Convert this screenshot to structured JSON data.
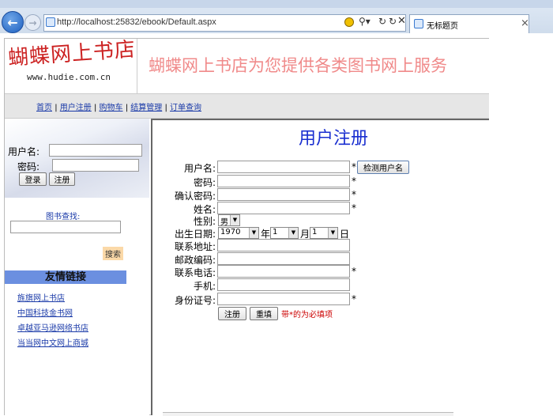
{
  "browser": {
    "url": "http://localhost:25832/ebook/Default.aspx",
    "tab_title": "无标题页",
    "tab_close": "×"
  },
  "header": {
    "logo_text": "蝴蝶网上书店",
    "logo_url": "www.hudie.com.cn",
    "banner_text": "蝴蝶网上书店为您提供各类图书网上服务"
  },
  "nav": {
    "items": [
      "首页",
      "用户注册",
      "购物车",
      "结算管理",
      "订单查询"
    ],
    "separator": "|"
  },
  "sidebar": {
    "username_label": "用户名:",
    "password_label": "密码:",
    "login_button": "登录",
    "register_button": "注册",
    "search_label": "图书查找:",
    "search_button": "搜索",
    "links_title": "友情链接",
    "links": [
      "旌旗网上书店",
      "中国科技金书网",
      "卓越亚马逊网络书店",
      "当当网中文网上商城"
    ]
  },
  "form": {
    "title": "用户注册",
    "username_label": "用户名:",
    "check_button": "检测用户名",
    "password_label": "密码:",
    "confirm_label": "确认密码:",
    "name_label": "姓名:",
    "gender_label": "性别:",
    "gender_value": "男",
    "birth_label": "出生日期:",
    "year_value": "1970",
    "year_unit": "年",
    "month_value": "1",
    "month_unit": "月",
    "day_value": "1",
    "day_unit": "日",
    "address_label": "联系地址:",
    "zip_label": "邮政编码:",
    "phone_label": "联系电话:",
    "mobile_label": "手机:",
    "id_label": "身份证号:",
    "required_mark": "*",
    "submit_button": "注册",
    "reset_button": "重填",
    "required_note": "带*的为必填项"
  },
  "colors": {
    "logo_red": "#cc2222",
    "banner_text": "#f08a8a",
    "title_blue": "#1a2fd0",
    "link_blue": "#1a3aa8",
    "links_header_bg": "#6b8fe0",
    "note_red": "#cc0000"
  }
}
